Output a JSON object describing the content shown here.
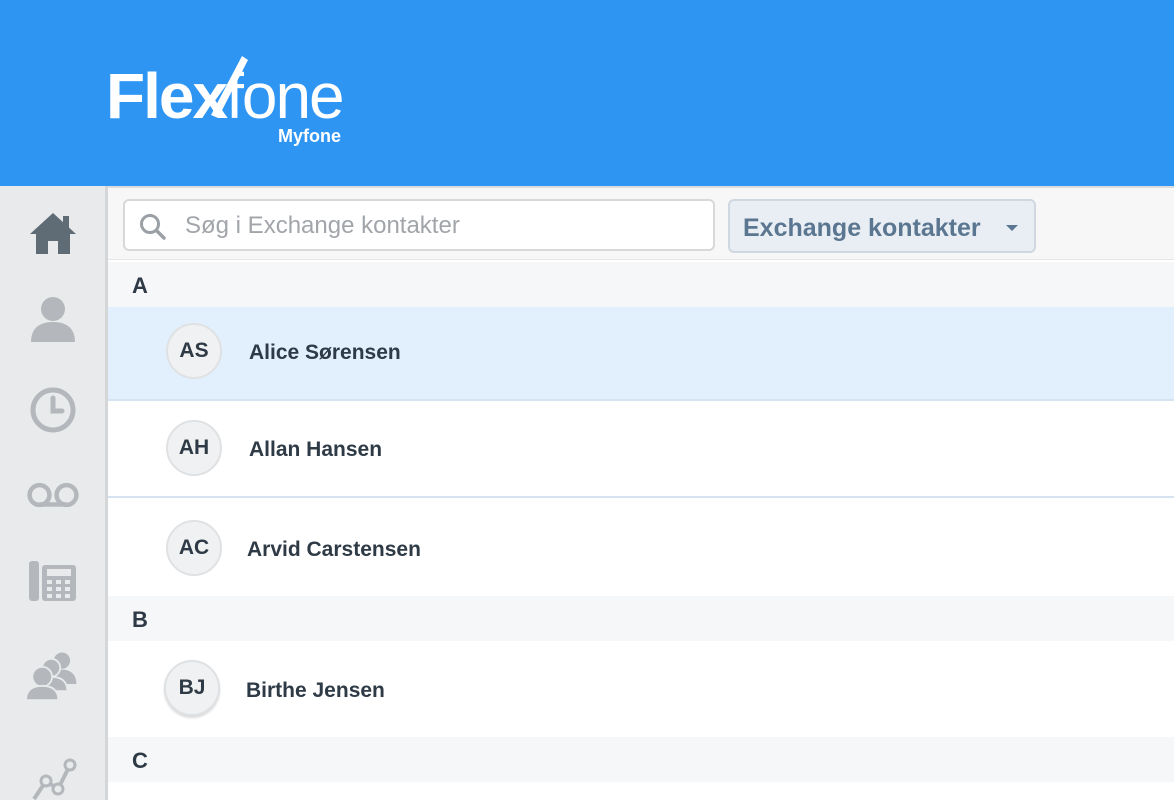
{
  "brand": {
    "name_bold": "Flex",
    "name_light": "fone",
    "subtitle": "Myfone",
    "color": "#2f95f3"
  },
  "sidebar": {
    "items": [
      {
        "icon": "home-icon"
      },
      {
        "icon": "user-icon"
      },
      {
        "icon": "clock-icon"
      },
      {
        "icon": "voicemail-icon"
      },
      {
        "icon": "desk-phone-icon"
      },
      {
        "icon": "group-icon"
      },
      {
        "icon": "stats-icon"
      }
    ]
  },
  "search": {
    "placeholder": "Søg i Exchange kontakter",
    "value": ""
  },
  "filter": {
    "selected": "Exchange kontakter"
  },
  "contacts": {
    "sections": [
      {
        "letter": "A",
        "items": [
          {
            "initials": "AS",
            "name": "Alice Sørensen"
          },
          {
            "initials": "AH",
            "name": "Allan Hansen"
          },
          {
            "initials": "AC",
            "name": "Arvid Carstensen"
          }
        ]
      },
      {
        "letter": "B",
        "items": [
          {
            "initials": "BJ",
            "name": "Birthe Jensen"
          }
        ]
      },
      {
        "letter": "C",
        "items": []
      }
    ]
  }
}
